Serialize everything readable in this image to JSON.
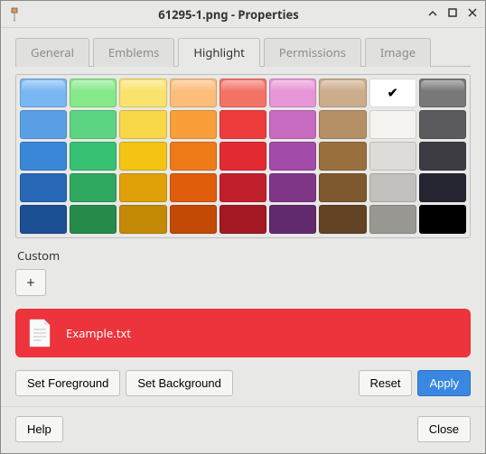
{
  "window": {
    "title": "61295-1.png - Properties"
  },
  "tabs": [
    {
      "label": "General",
      "active": false
    },
    {
      "label": "Emblems",
      "active": false
    },
    {
      "label": "Highlight",
      "active": true
    },
    {
      "label": "Permissions",
      "active": false
    },
    {
      "label": "Image",
      "active": false
    }
  ],
  "swatches": {
    "selected": [
      0,
      7
    ],
    "grid": [
      [
        "#79b7f2",
        "#86e989",
        "#f9e36c",
        "#fcbd7a",
        "#f37366",
        "#e696d6",
        "#cbac8b",
        "#ffffff",
        "#787878"
      ],
      [
        "#5a9fe6",
        "#5dd481",
        "#f8d748",
        "#f89f39",
        "#ee3c3c",
        "#c76bc0",
        "#b58f65",
        "#f5f3ef",
        "#5b5b5e"
      ],
      [
        "#3a87d8",
        "#37c172",
        "#f3c412",
        "#ee7b18",
        "#e22a33",
        "#a24ba8",
        "#9a703f",
        "#dedcd8",
        "#3d3c43"
      ],
      [
        "#2668b6",
        "#2ea95f",
        "#e0a108",
        "#e05d0b",
        "#c21f2c",
        "#803788",
        "#7e592f",
        "#c2c0bc",
        "#262532"
      ],
      [
        "#1c4f94",
        "#268a4a",
        "#c48a05",
        "#c34a04",
        "#a31823",
        "#622a6e",
        "#634324",
        "#9a9893",
        "#000000"
      ]
    ]
  },
  "custom_label": "Custom",
  "add_label": "+",
  "preview": {
    "filename": "Example.txt",
    "bg": "#ed333b",
    "fg": "#ffffff"
  },
  "buttons": {
    "set_foreground": "Set Foreground",
    "set_background": "Set Background",
    "reset": "Reset",
    "apply": "Apply",
    "help": "Help",
    "close": "Close"
  }
}
